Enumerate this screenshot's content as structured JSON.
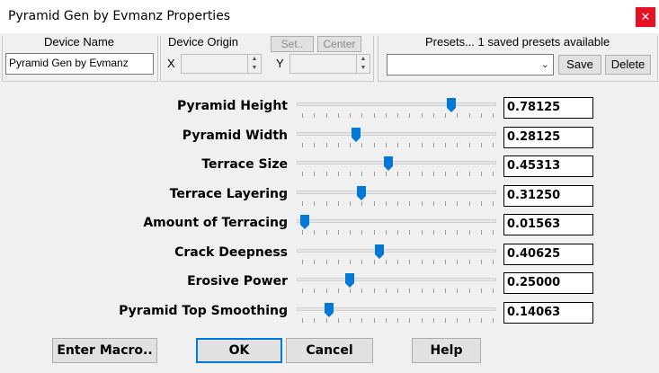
{
  "window": {
    "title": "Pyramid Gen by Evmanz Properties",
    "close_glyph": "✕"
  },
  "device": {
    "name_label": "Device Name",
    "name_value": "Pyramid Gen by Evmanz",
    "origin_label": "Device Origin",
    "x_label": "X",
    "y_label": "Y",
    "set_label": "Set..",
    "center_label": "Center"
  },
  "presets": {
    "label": "Presets... 1 saved presets available",
    "selected": "",
    "save_label": "Save",
    "delete_label": "Delete"
  },
  "params": [
    {
      "label": "Pyramid Height",
      "value": "0.78125",
      "fraction": 0.78125
    },
    {
      "label": "Pyramid Width",
      "value": "0.28125",
      "fraction": 0.28125
    },
    {
      "label": "Terrace Size",
      "value": "0.45313",
      "fraction": 0.45313
    },
    {
      "label": "Terrace Layering",
      "value": "0.31250",
      "fraction": 0.3125
    },
    {
      "label": "Amount of Terracing",
      "value": "0.01563",
      "fraction": 0.01563
    },
    {
      "label": "Crack Deepness",
      "value": "0.40625",
      "fraction": 0.40625
    },
    {
      "label": "Erosive Power",
      "value": "0.25000",
      "fraction": 0.25
    },
    {
      "label": "Pyramid Top Smoothing",
      "value": "0.14063",
      "fraction": 0.14063
    }
  ],
  "buttons": {
    "macro": "Enter Macro..",
    "ok": "OK",
    "cancel": "Cancel",
    "help": "Help"
  },
  "colors": {
    "accent": "#0078d7",
    "close": "#e81123"
  }
}
